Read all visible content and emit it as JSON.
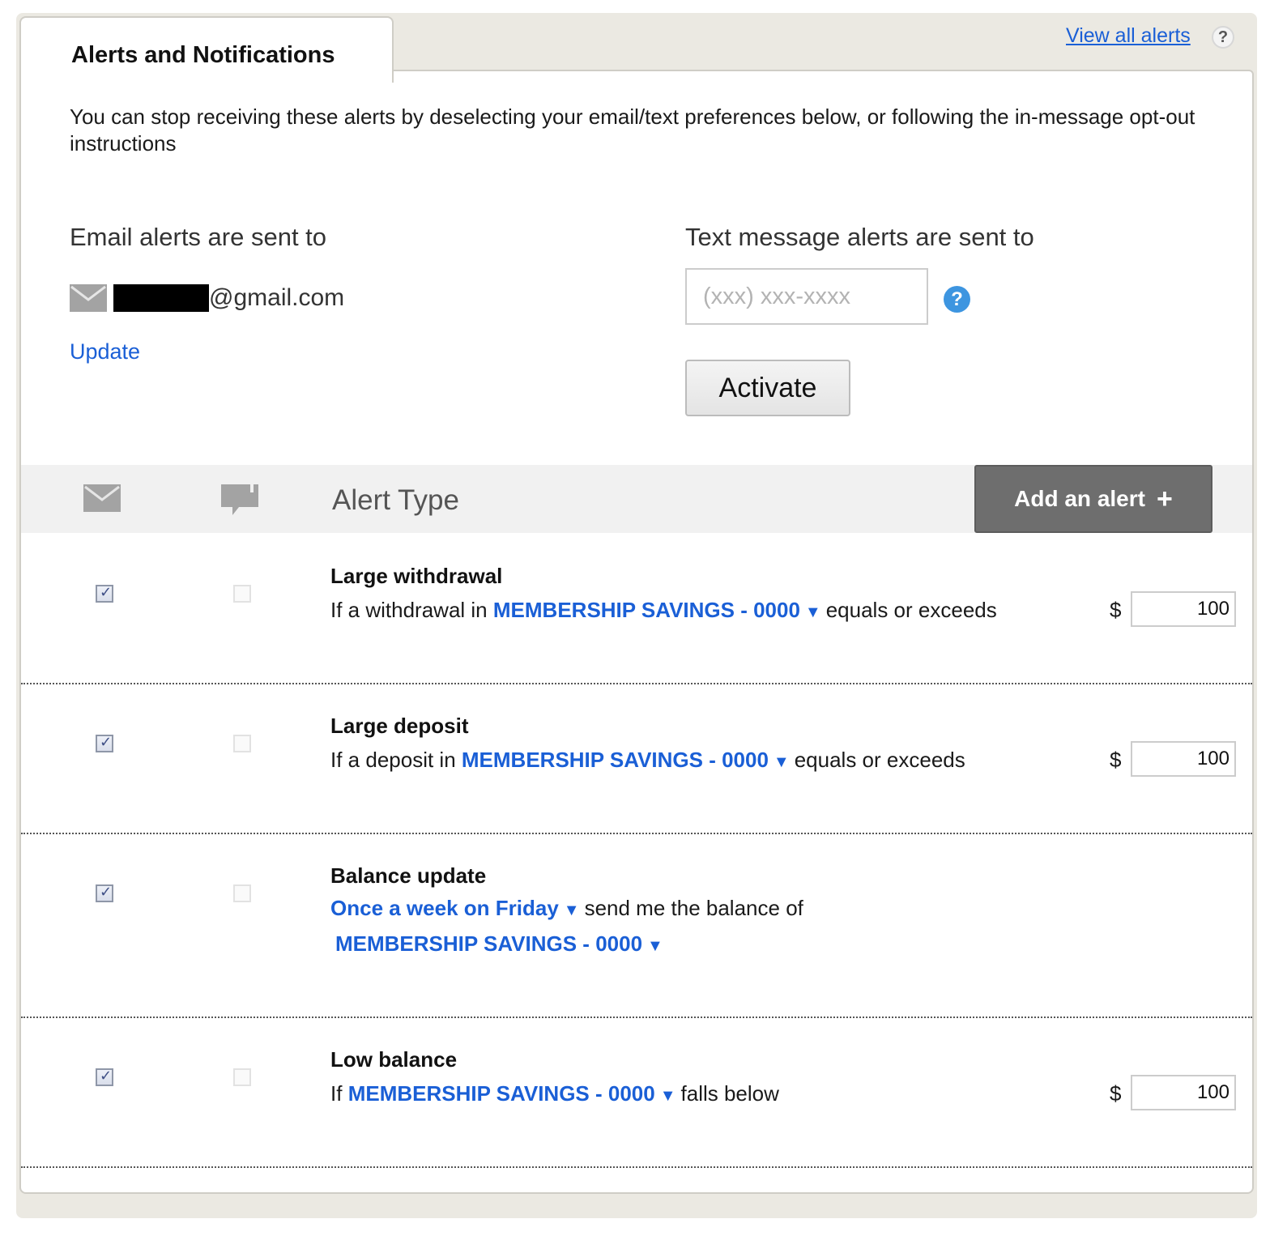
{
  "tab": {
    "title": "Alerts and Notifications"
  },
  "top_links": {
    "view_all": "View all alerts",
    "help": "?"
  },
  "intro": "You can stop receiving these alerts by deselecting your email/text preferences below, or following the in-message opt-out instructions",
  "email": {
    "heading": "Email alerts are sent to",
    "address_domain": "@gmail.com",
    "update_label": "Update"
  },
  "text": {
    "heading": "Text message alerts are sent to",
    "phone_placeholder": "(xxx) xxx-xxxx",
    "phone_value": "",
    "help": "?",
    "activate_label": "Activate"
  },
  "table": {
    "alert_type_header": "Alert Type",
    "add_alert_label": "Add an alert",
    "add_alert_icon": "+",
    "rows": [
      {
        "title": "Large withdrawal",
        "prefix": "If a withdrawal in",
        "account": "MEMBERSHIP SAVINGS - 0000",
        "suffix": "equals or exceeds",
        "currency": "$",
        "amount": "100",
        "email_checked": true,
        "text_checked": false
      },
      {
        "title": "Large deposit",
        "prefix": "If a deposit in",
        "account": "MEMBERSHIP SAVINGS - 0000",
        "suffix": "equals or exceeds",
        "currency": "$",
        "amount": "100",
        "email_checked": true,
        "text_checked": false
      },
      {
        "title": "Balance update",
        "frequency": "Once a week on Friday",
        "suffix": "send me the balance of",
        "account": "MEMBERSHIP SAVINGS - 0000",
        "email_checked": true,
        "text_checked": false
      },
      {
        "title": "Low balance",
        "prefix": "If",
        "account": "MEMBERSHIP SAVINGS - 0000",
        "suffix": "falls below",
        "currency": "$",
        "amount": "100",
        "email_checked": true,
        "text_checked": false
      }
    ]
  },
  "colors": {
    "link": "#1a5fd6",
    "frame": "#ebe9e2",
    "header_bar": "#f1f1f1",
    "add_button": "#6e6e6e",
    "help_blue": "#3d95e0"
  }
}
